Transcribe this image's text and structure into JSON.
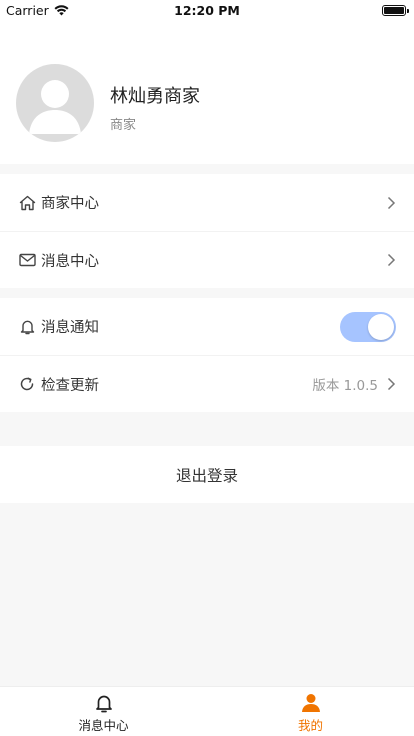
{
  "status_bar": {
    "carrier": "Carrier",
    "time": "12:20 PM"
  },
  "profile": {
    "name": "林灿勇商家",
    "role": "商家"
  },
  "menu_group_1": [
    {
      "label": "商家中心",
      "icon": "home-icon"
    },
    {
      "label": "消息中心",
      "icon": "mail-icon"
    }
  ],
  "menu_group_2": {
    "notification": {
      "label": "消息通知",
      "icon": "bell-icon",
      "enabled": true
    },
    "update": {
      "label": "检查更新",
      "icon": "refresh-icon",
      "version": "版本 1.0.5"
    }
  },
  "logout_label": "退出登录",
  "tabbar": [
    {
      "label": "消息中心",
      "icon": "bell-icon",
      "active": false
    },
    {
      "label": "我的",
      "icon": "person-icon",
      "active": true
    }
  ],
  "colors": {
    "accent": "#f07400",
    "toggle_on": "#a6c4ff",
    "background": "#f7f7f7"
  }
}
